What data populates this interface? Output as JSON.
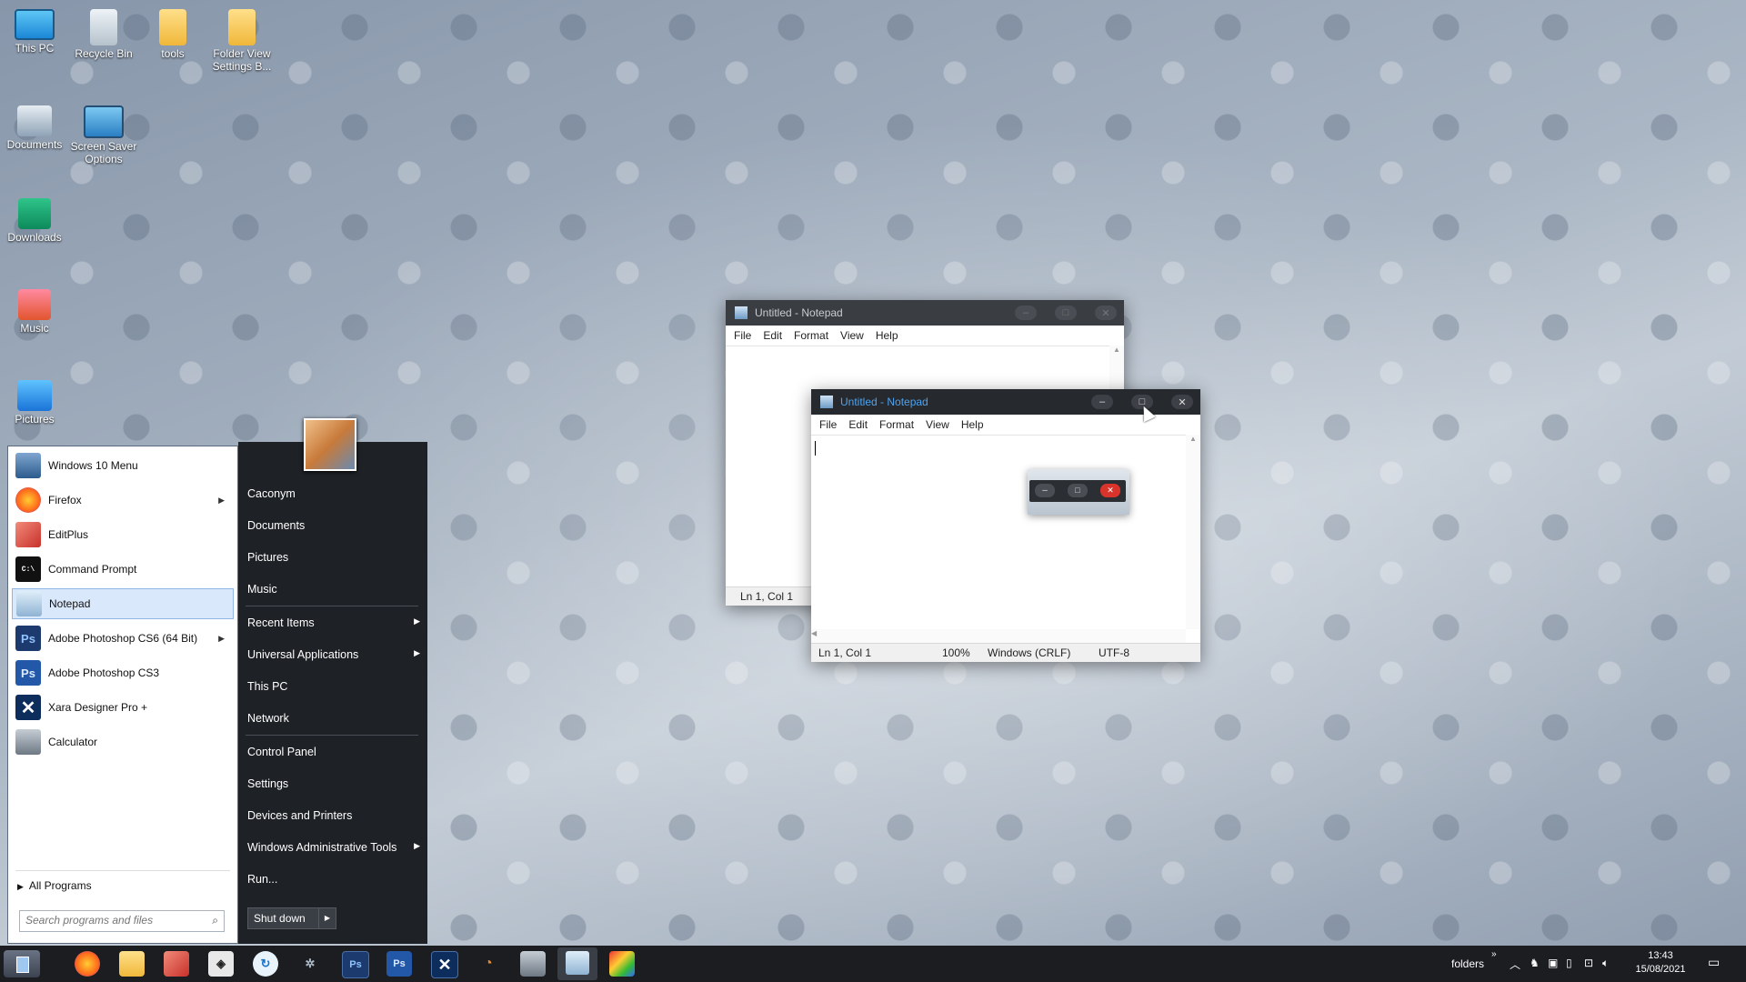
{
  "desktop_icons": [
    {
      "label": "This PC"
    },
    {
      "label": "Recycle Bin"
    },
    {
      "label": "tools"
    },
    {
      "label": "Folder View Settings B..."
    },
    {
      "label": "Documents"
    },
    {
      "label": "Screen Saver Options"
    },
    {
      "label": "Downloads"
    },
    {
      "label": "Music"
    },
    {
      "label": "Pictures"
    }
  ],
  "start_menu": {
    "pinned": [
      {
        "label": "Windows 10 Menu"
      },
      {
        "label": "Firefox"
      },
      {
        "label": "EditPlus"
      },
      {
        "label": "Command Prompt"
      },
      {
        "label": "Notepad"
      },
      {
        "label": "Adobe Photoshop CS6 (64 Bit)"
      },
      {
        "label": "Adobe Photoshop CS3"
      },
      {
        "label": "Xara Designer Pro +"
      },
      {
        "label": "Calculator"
      }
    ],
    "all_programs": "All Programs",
    "search_placeholder": "Search programs and files",
    "right": {
      "user": "Caconym",
      "documents": "Documents",
      "pictures": "Pictures",
      "music": "Music",
      "recent_items": "Recent Items",
      "universal_apps": "Universal Applications",
      "this_pc": "This PC",
      "network": "Network",
      "control_panel": "Control Panel",
      "settings": "Settings",
      "devices": "Devices and Printers",
      "admin_tools": "Windows Administrative Tools",
      "run": "Run..."
    },
    "shutdown": "Shut down"
  },
  "notepad_back": {
    "title": "Untitled - Notepad",
    "menu": [
      "File",
      "Edit",
      "Format",
      "View",
      "Help"
    ],
    "status_pos": "Ln 1, Col 1"
  },
  "notepad_front": {
    "title": "Untitled - Notepad",
    "menu": [
      "File",
      "Edit",
      "Format",
      "View",
      "Help"
    ],
    "status": {
      "pos": "Ln 1, Col 1",
      "zoom": "100%",
      "eol": "Windows (CRLF)",
      "enc": "UTF-8"
    }
  },
  "tray": {
    "toolbar_label": "folders",
    "time": "13:43",
    "date": "15/08/2021"
  },
  "colors": {
    "taskbar": "#1b1d21",
    "start_right": "#1e2126",
    "accent": "#3b8ee6",
    "close_red": "#d9342b"
  }
}
